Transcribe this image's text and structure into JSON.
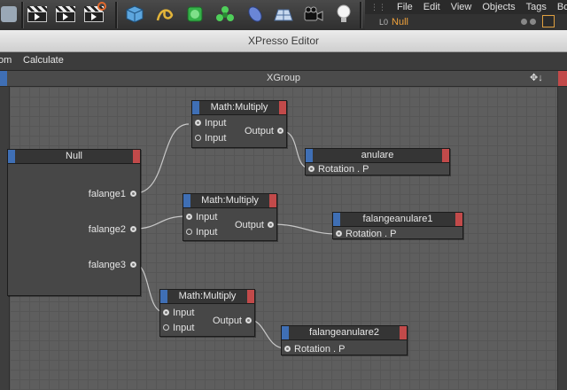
{
  "app_menu": [
    "File",
    "Edit",
    "View",
    "Objects",
    "Tags",
    "Bo"
  ],
  "object_row": {
    "name": "Null",
    "prefix": "L0"
  },
  "window": {
    "title": "XPresso Editor"
  },
  "menubar": {
    "items": [
      "om",
      "Calculate"
    ]
  },
  "group": {
    "title": "XGroup",
    "nav_icon": "✥↓"
  },
  "nodes": {
    "null": {
      "title": "Null",
      "ports": [
        "falange1",
        "falange2",
        "falange3"
      ]
    },
    "mult1": {
      "title": "Math:Multiply",
      "in1": "Input",
      "in2": "Input",
      "out": "Output"
    },
    "mult2": {
      "title": "Math:Multiply",
      "in1": "Input",
      "in2": "Input",
      "out": "Output"
    },
    "mult3": {
      "title": "Math:Multiply",
      "in1": "Input",
      "in2": "Input",
      "out": "Output"
    },
    "anulare": {
      "title": "anulare",
      "port": "Rotation . P"
    },
    "fal1": {
      "title": "falangeanulare1",
      "port": "Rotation . P"
    },
    "fal2": {
      "title": "falangeanulare2",
      "port": "Rotation . P"
    }
  },
  "colors": {
    "node_blue": "#3f6fb5",
    "node_red": "#c24a4a",
    "wire": "#c8c8c8"
  }
}
